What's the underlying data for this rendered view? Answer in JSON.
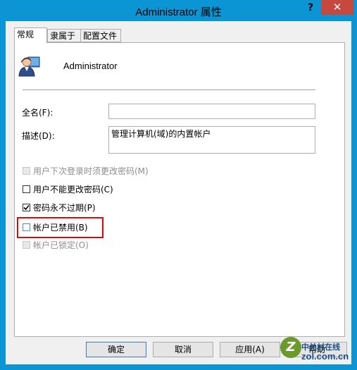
{
  "window": {
    "title": "Administrator 属性",
    "help": "?",
    "close": "✕"
  },
  "tabs": [
    {
      "label": "常规",
      "active": true
    },
    {
      "label": "隶属于",
      "active": false
    },
    {
      "label": "配置文件",
      "active": false
    }
  ],
  "general": {
    "username": "Administrator",
    "fullname_label": "全名(F):",
    "fullname_value": "",
    "description_label": "描述(D):",
    "description_value": "管理计算机(域)的内置帐户",
    "checkboxes": [
      {
        "label": "用户下次登录时须更改密码(M)",
        "checked": false,
        "disabled": true
      },
      {
        "label": "用户不能更改密码(C)",
        "checked": false,
        "disabled": false
      },
      {
        "label": "密码永不过期(P)",
        "checked": true,
        "disabled": false
      },
      {
        "label": "帐户已禁用(B)",
        "checked": false,
        "disabled": false,
        "highlighted": true
      },
      {
        "label": "帐户已锁定(O)",
        "checked": false,
        "disabled": true
      }
    ]
  },
  "buttons": {
    "ok": "确定",
    "cancel": "取消",
    "apply": "应用(A)",
    "help_btn": "帮助"
  },
  "watermark": {
    "logo": "Z",
    "cn": "中关村在线",
    "en": "zol.com.cn"
  },
  "colors": {
    "frame": "#0b95d4",
    "close": "#c7483f",
    "highlight": "#e00000"
  }
}
